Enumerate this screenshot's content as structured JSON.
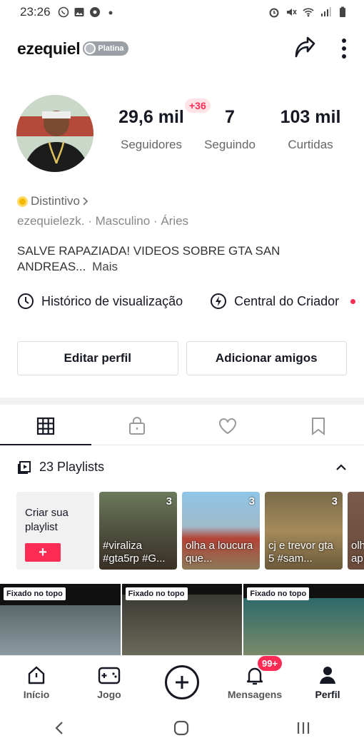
{
  "status": {
    "time": "23:26",
    "left_icons": [
      "whatsapp-icon",
      "gallery-icon",
      "ball-icon",
      "dot-icon"
    ],
    "right_icons": [
      "alarm-icon",
      "mute-icon",
      "wifi-icon",
      "signal-icon",
      "battery-icon"
    ]
  },
  "header": {
    "username": "ezequiel",
    "badge": "Platina"
  },
  "stats": {
    "new_followers": "+36",
    "followers_value": "29,6 mil",
    "followers_label": "Seguidores",
    "following_value": "7",
    "following_label": "Seguindo",
    "likes_value": "103 mil",
    "likes_label": "Curtidas"
  },
  "profile": {
    "badge_link": "Distintivo",
    "handle": "ezequielezk.",
    "gender": "Masculino",
    "sign": "Áries",
    "bio": "SALVE RAPAZIADA! VIDEOS SOBRE GTA SAN ANDREAS...",
    "more": "Mais"
  },
  "links": {
    "history": "Histórico de visualização",
    "creator": "Central do Criador"
  },
  "buttons": {
    "edit": "Editar perfil",
    "add_friends": "Adicionar amigos"
  },
  "playlists": {
    "header": "23 Playlists",
    "create_label": "Criar sua playlist",
    "create_button": "+",
    "items": [
      {
        "count": "3",
        "text": "#viraliza #gta5rp #G..."
      },
      {
        "count": "3",
        "text": "olha a loucura que..."
      },
      {
        "count": "3",
        "text": "cj e trevor gta 5 #sam..."
      },
      {
        "count": "",
        "text": "olh ap"
      }
    ]
  },
  "grid": {
    "pinned_label": "Fixado no topo"
  },
  "nav": {
    "home": "Início",
    "game": "Jogo",
    "messages": "Mensagens",
    "messages_badge": "99+",
    "profile": "Perfil"
  }
}
